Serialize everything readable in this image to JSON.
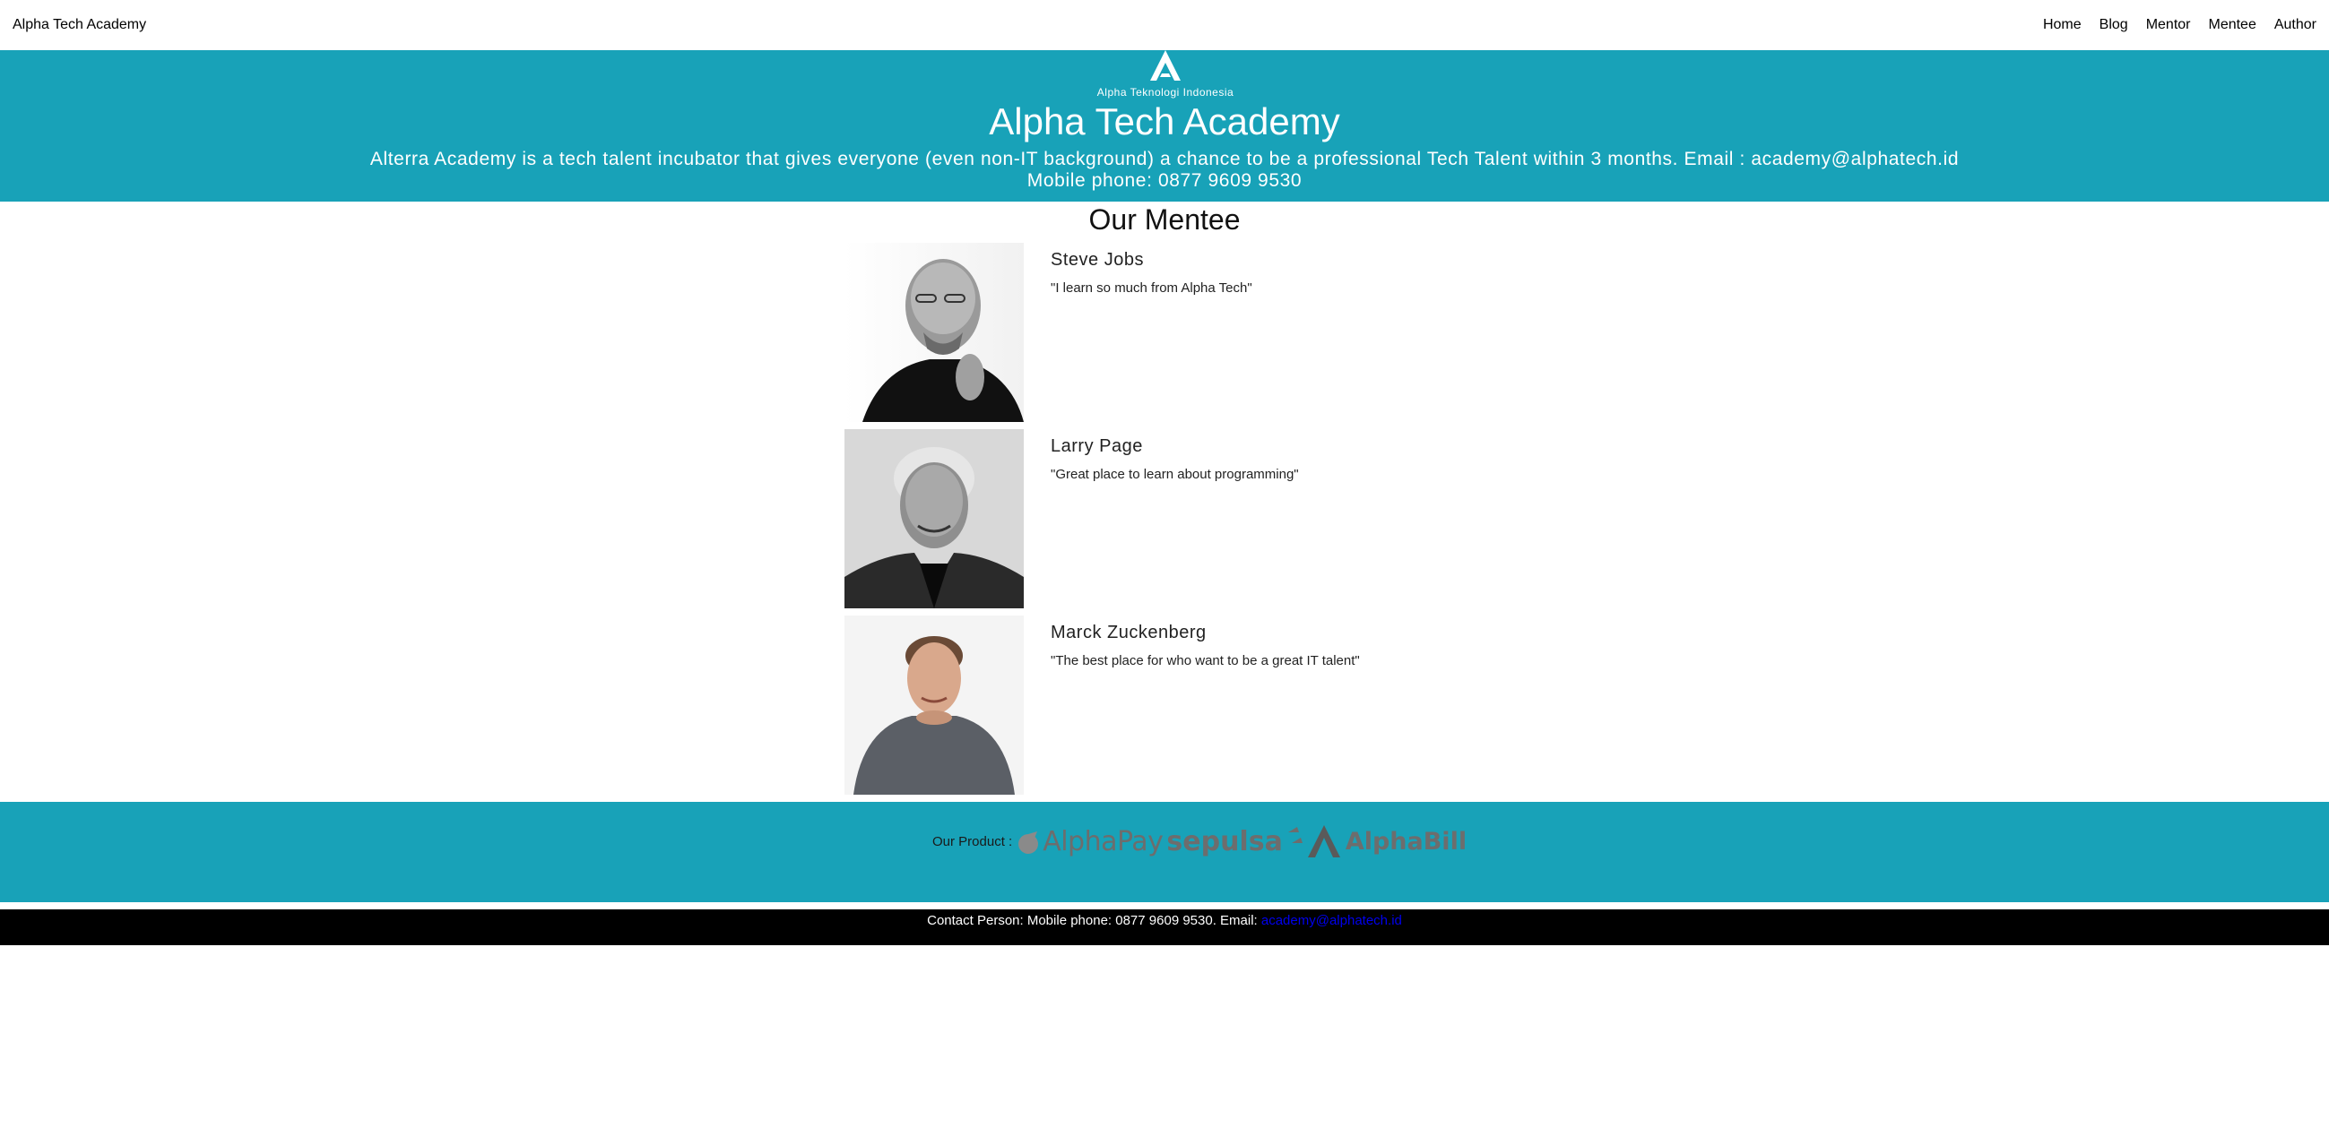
{
  "navbar": {
    "brand": "Alpha Tech Academy",
    "links": [
      "Home",
      "Blog",
      "Mentor",
      "Mentee",
      "Author"
    ]
  },
  "hero": {
    "logo_text": "Alpha Teknologi Indonesia",
    "title": "Alpha Tech Academy",
    "description_line1": "Alterra Academy is a tech talent incubator that gives everyone (even non-IT background) a chance to be a professional Tech Talent within 3 months. Email : academy@alphatech.id",
    "description_line2": "Mobile phone: 0877 9609 9530"
  },
  "mentee_section": {
    "title": "Our Mentee",
    "mentees": [
      {
        "name": "Steve Jobs",
        "quote": "\"I learn so much from Alpha Tech\""
      },
      {
        "name": "Larry Page",
        "quote": "\"Great place to learn about programming\""
      },
      {
        "name": "Marck Zuckenberg",
        "quote": "\"The best place for who want to be a great IT talent\""
      }
    ]
  },
  "products": {
    "label": "Our Product :",
    "items": [
      "AlphaPay",
      "sepulsa",
      "AlphaBill"
    ]
  },
  "contact": {
    "text": "Contact Person: Mobile phone: 0877 9609 9530. Email: ",
    "email": "academy@alphatech.id"
  },
  "colors": {
    "teal": "#18a2b8",
    "link": "#0000ee"
  }
}
